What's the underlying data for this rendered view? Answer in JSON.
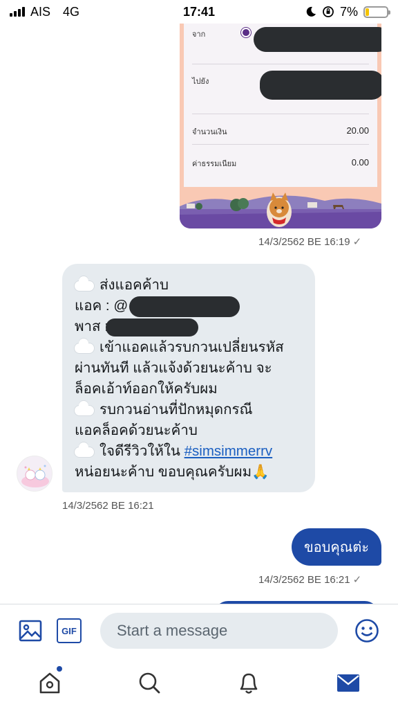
{
  "status_bar": {
    "carrier": "AIS",
    "network": "4G",
    "time": "17:41",
    "battery_percent": "7%",
    "battery_level": 0.07,
    "battery_color": "#f5c400"
  },
  "receipt": {
    "from_label": "จาก",
    "to_label": "ไปยัง",
    "amount_label": "จำนวนเงิน",
    "amount_value": "20.00",
    "fee_label": "ค่าธรรมเนียม",
    "fee_value": "0.00",
    "timestamp": "14/3/2562 BE 16:19",
    "status_icon": "check-icon"
  },
  "incoming_message": {
    "lines": [
      "ส่งแอคค้าบ",
      "แอค : @",
      "พาส :",
      "เข้าแอคแล้วรบกวนเปลี่ยนรหัส",
      "ผ่านทันที แล้วแจ้งด้วยนะค้าบ จะ",
      "ล็อคเอ้าท์ออกให้ครับผม",
      "รบกวนอ่านที่ปักหมุดกรณี",
      "แอคล็อคด้วยนะค้าบ",
      "ใจดีรีวิวให้ใน",
      "#simsimmerrv",
      "หน่อยนะค้าบ ขอบคุณครับผม"
    ],
    "emoji_prefix_icon": "cloud-icon",
    "emoji_suffix": "🙏",
    "timestamp": "14/3/2562 BE 16:21"
  },
  "outgoing_message": {
    "text": "ขอบคุณต่ะ",
    "timestamp": "14/3/2562 BE 16:21",
    "status_icon": "check-icon"
  },
  "composer": {
    "placeholder": "Start a message",
    "gif_label": "GIF"
  },
  "tabbar": {
    "items": [
      "home",
      "search",
      "notifications",
      "messages"
    ],
    "active": "messages"
  },
  "colors": {
    "accent": "#1e4aa6",
    "bubble_in": "#e6ebef",
    "link": "#1b5fc1"
  }
}
